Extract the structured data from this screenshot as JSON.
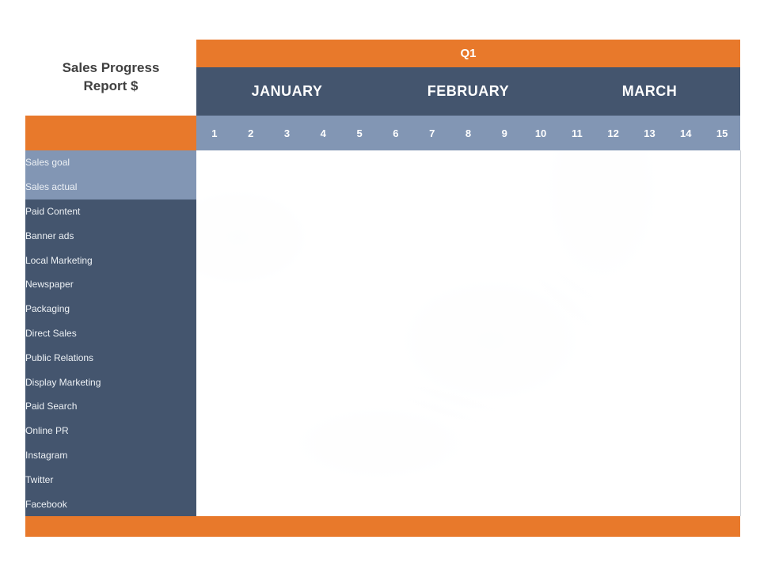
{
  "report": {
    "title_line1": "Sales Progress",
    "title_line2": "Report $",
    "quarter_label": "Q1"
  },
  "colors": {
    "accent_orange": "#E8792B",
    "header_dark_blue": "#44556E",
    "header_light_blue": "#8296B4",
    "grid_line": "#CFD3D8",
    "text_white": "#FFFFFF",
    "title_text": "#404040"
  },
  "months": [
    {
      "label": "JANUARY",
      "span": 5
    },
    {
      "label": "FEBRUARY",
      "span": 5
    },
    {
      "label": "MARCH",
      "span": 5
    }
  ],
  "days": [
    "1",
    "2",
    "3",
    "4",
    "5",
    "6",
    "7",
    "8",
    "9",
    "10",
    "11",
    "12",
    "13",
    "14",
    "15"
  ],
  "rows": [
    {
      "label": "Sales goal",
      "style": "light"
    },
    {
      "label": "Sales actual",
      "style": "light"
    },
    {
      "label": "Paid Content",
      "style": "dark"
    },
    {
      "label": "Banner ads",
      "style": "dark"
    },
    {
      "label": "Local Marketing",
      "style": "dark"
    },
    {
      "label": "Newspaper",
      "style": "dark"
    },
    {
      "label": "Packaging",
      "style": "dark"
    },
    {
      "label": "Direct Sales",
      "style": "dark"
    },
    {
      "label": "Public Relations",
      "style": "dark"
    },
    {
      "label": "Display Marketing",
      "style": "dark"
    },
    {
      "label": "Paid Search",
      "style": "dark"
    },
    {
      "label": "Online PR",
      "style": "dark"
    },
    {
      "label": "Instagram",
      "style": "dark"
    },
    {
      "label": "Twitter",
      "style": "dark"
    },
    {
      "label": "Facebook",
      "style": "dark"
    }
  ],
  "footer": {
    "label": "",
    "cells": [
      "",
      "",
      "",
      "",
      "",
      "",
      "",
      "",
      "",
      "",
      "",
      "",
      "",
      "",
      ""
    ]
  }
}
